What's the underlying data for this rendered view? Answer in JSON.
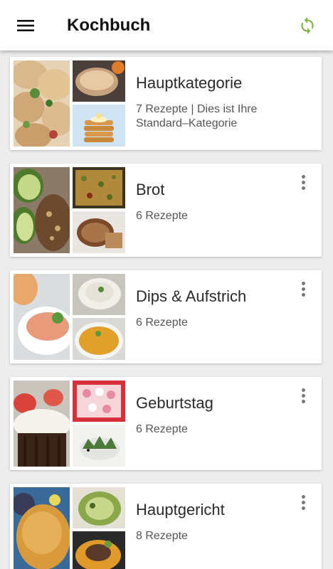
{
  "appbar": {
    "title": "Kochbuch",
    "menu_icon": "hamburger-menu-icon",
    "sync_icon": "sync-icon",
    "accent": "#7cb342"
  },
  "categories": [
    {
      "name": "Hauptkategorie",
      "subtitle": "7 Rezepte | Dies ist Ihre Standard–Kategorie",
      "has_menu": false
    },
    {
      "name": "Brot",
      "subtitle": "6 Rezepte",
      "has_menu": true
    },
    {
      "name": "Dips & Aufstrich",
      "subtitle": "6 Rezepte",
      "has_menu": true
    },
    {
      "name": "Geburtstag",
      "subtitle": "6 Rezepte",
      "has_menu": true
    },
    {
      "name": "Hauptgericht",
      "subtitle": "8 Rezepte",
      "has_menu": true
    }
  ]
}
